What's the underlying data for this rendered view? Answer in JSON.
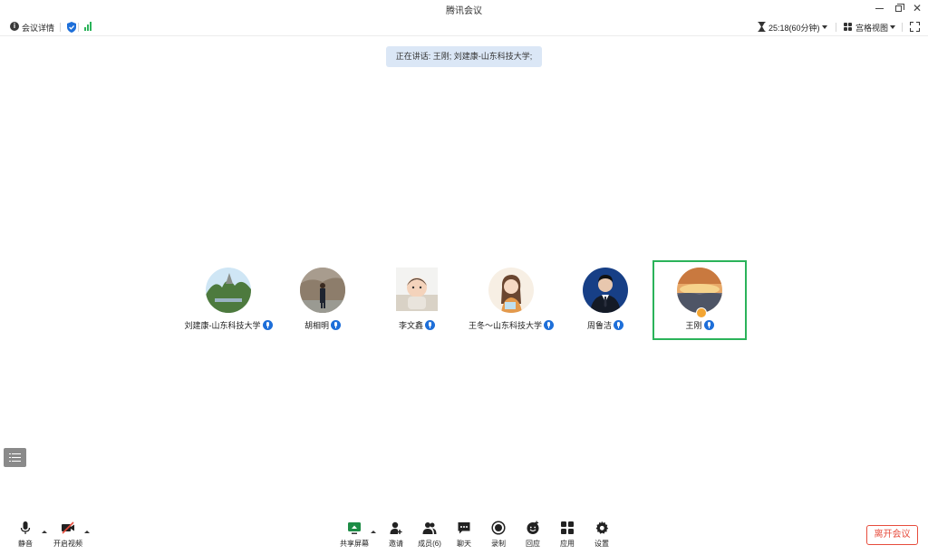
{
  "window": {
    "title": "腾讯会议"
  },
  "infobar": {
    "meeting_info_label": "会议详情",
    "timer": "25:18(60分钟)",
    "view_label": "宫格视图"
  },
  "speaking": "正在讲话: 王刚; 刘建康-山东科技大学;",
  "participants": [
    {
      "name": "刘建康-山东科技大学",
      "avatar": "landscape-photo",
      "active": false
    },
    {
      "name": "胡相明",
      "avatar": "person-outdoor-photo",
      "active": false
    },
    {
      "name": "李文鑫",
      "avatar": "baby-photo",
      "active": false
    },
    {
      "name": "王冬～山东科技大学",
      "avatar": "illustrated-girl",
      "active": false
    },
    {
      "name": "周鲁洁",
      "avatar": "man-in-suit-photo",
      "active": false
    },
    {
      "name": "王刚",
      "avatar": "sunset-landscape",
      "active": true,
      "host": true
    }
  ],
  "toolbar": {
    "mute": "静音",
    "video": "开启视频",
    "share": "共享屏幕",
    "invite": "邀请",
    "members": "成员(6)",
    "chat": "聊天",
    "record": "录制",
    "reaction": "回应",
    "apps": "应用",
    "settings": "设置",
    "leave": "离开会议"
  },
  "colors": {
    "accent": "#1e6fd9",
    "active_border": "#2bb35a",
    "leave": "#e74c3c",
    "banner": "#dbe7f6"
  }
}
